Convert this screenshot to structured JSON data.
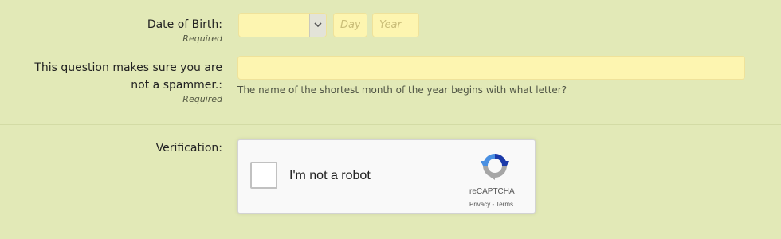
{
  "dob": {
    "label": "Date of Birth:",
    "required": "Required",
    "month_value": "",
    "day_placeholder": "Day",
    "year_placeholder": "Year"
  },
  "spam_question": {
    "label_line1": "This question makes sure you are",
    "label_line2": "not a spammer.:",
    "required": "Required",
    "answer_value": "",
    "explain": "The name of the shortest month of the year begins with what letter?"
  },
  "verification": {
    "label": "Verification:",
    "checkbox_label": "I'm not a robot",
    "brand": "reCAPTCHA",
    "privacy": "Privacy",
    "separator": " - ",
    "terms": "Terms"
  },
  "colors": {
    "background": "#e2e9b7",
    "field_fill": "#fdf5b0",
    "captcha_blue": "#4a90e2",
    "captcha_dark_blue": "#1c3aa9",
    "captcha_gray": "#a6a6a6"
  },
  "icons": {
    "select_arrow": "chevron-down-icon",
    "captcha_logo": "recaptcha-logo-icon"
  }
}
